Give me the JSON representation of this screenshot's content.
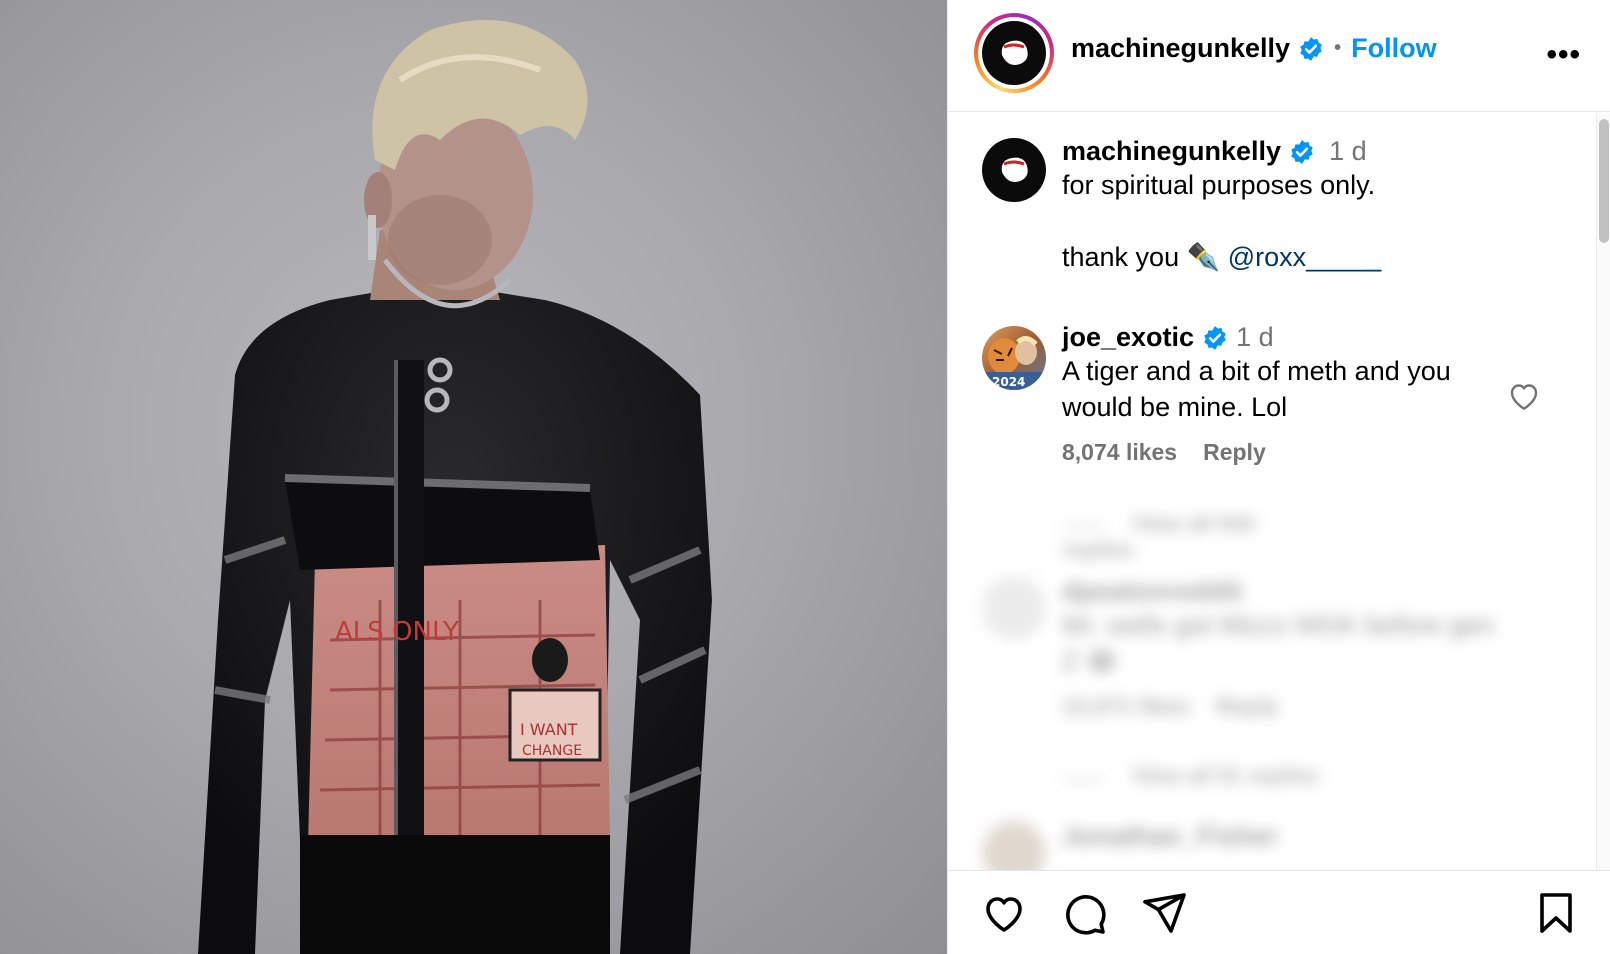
{
  "post": {
    "username": "machinegunkelly",
    "follow_label": "Follow",
    "separator": "•",
    "more_label": "•••"
  },
  "caption": {
    "username": "machinegunkelly",
    "time": "1 d",
    "line1": "for spiritual purposes only.",
    "line2_prefix": "thank you ✒️ ",
    "mention": "@roxx_____"
  },
  "comment": {
    "username": "joe_exotic",
    "time": "1 d",
    "text": "A tiger and a bit of meth and you would be mine. Lol",
    "likes": "8,074 likes",
    "reply_label": "Reply",
    "avatar_badge": "2024"
  },
  "blurred": {
    "view_replies_1": "View all 543 replies",
    "username": "dpeatonreddit",
    "text": "Mr. wells got Mizzz MGK before gen Z 😂",
    "likes": "12,071 likes",
    "reply_label": "Reply",
    "view_replies_2": "View all 51 replies",
    "username_2": "Jonathan_Fisher"
  },
  "colors": {
    "accent": "#0095f6",
    "verified": "#0095f6",
    "mention": "#00376b",
    "secondary_text": "#737373"
  },
  "icons": {
    "like": "heart-icon",
    "comment": "comment-bubble-icon",
    "share": "paper-plane-icon",
    "save": "bookmark-icon",
    "more": "more-horizontal-icon",
    "verified": "verified-badge-icon"
  }
}
